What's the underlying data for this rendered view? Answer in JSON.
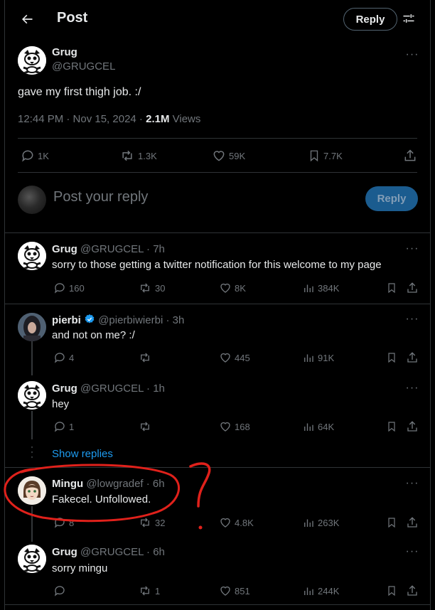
{
  "header": {
    "title": "Post",
    "reply_label": "Reply"
  },
  "main_post": {
    "name": "Grug",
    "handle": "@GRUGCEL",
    "text": "gave my first thigh job. :/",
    "time": "12:44 PM · Nov 15, 2024 · ",
    "views_count": "2.1M",
    "views_label": " Views",
    "stats": {
      "replies": "1K",
      "reposts": "1.3K",
      "likes": "59K",
      "bookmarks": "7.7K"
    }
  },
  "composer": {
    "placeholder": "Post your reply",
    "button": "Reply"
  },
  "replies": [
    {
      "name": "Grug",
      "meta": "@GRUGCEL · 7h",
      "text": "sorry to those getting a twitter notification for this welcome to my page",
      "replies": "160",
      "reposts": "30",
      "likes": "8K",
      "views": "384K"
    },
    {
      "name": "pierbi",
      "meta": "@pierbiwierbi · 3h",
      "text": "and not on me? :/",
      "replies": "4",
      "reposts": "",
      "likes": "445",
      "views": "91K"
    },
    {
      "name": "Grug",
      "meta": "@GRUGCEL · 1h",
      "text": "hey",
      "replies": "1",
      "reposts": "",
      "likes": "168",
      "views": "64K"
    },
    {
      "name": "Mingu",
      "meta": "@lowgradef · 6h",
      "text": "Fakecel. Unfollowed.",
      "replies": "8",
      "reposts": "32",
      "likes": "4.8K",
      "views": "263K"
    },
    {
      "name": "Grug",
      "meta": "@GRUGCEL · 6h",
      "text": "sorry mingu",
      "replies": "",
      "reposts": "1",
      "likes": "851",
      "views": "244K"
    }
  ],
  "show_replies": "Show replies",
  "annotation": {
    "mark": "?",
    "color": "#e0211b"
  },
  "colors": {
    "accent": "#1d9bf0",
    "muted": "#71767b",
    "text": "#e7e9ea",
    "verified": "#1d9bf0"
  }
}
